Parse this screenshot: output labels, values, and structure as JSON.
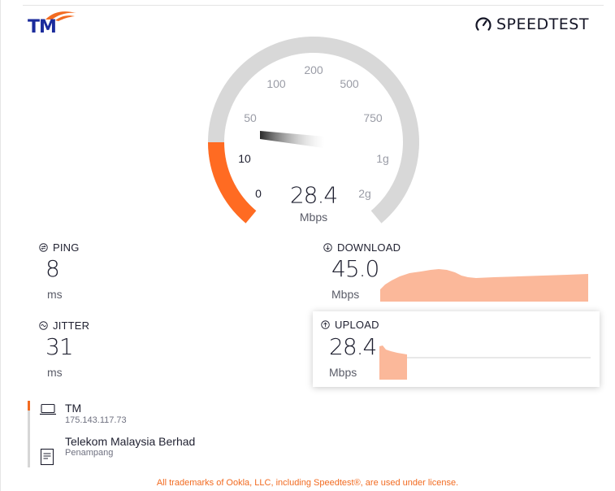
{
  "brand": {
    "isp_logo_text": "TM",
    "speedtest_logo_text": "SPEEDTEST"
  },
  "gauge": {
    "scale_labels": [
      "0",
      "10",
      "50",
      "100",
      "200",
      "500",
      "750",
      "1g",
      "2g"
    ],
    "active_label": "10",
    "value": "28.4",
    "unit": "Mbps",
    "fill_colour": "#ff6b22",
    "track_colour": "#d8d8d8"
  },
  "ping": {
    "label": "PING",
    "value": "8",
    "unit": "ms",
    "icon": "ping-icon"
  },
  "jitter": {
    "label": "JITTER",
    "value": "31",
    "unit": "ms",
    "icon": "jitter-icon"
  },
  "download": {
    "label": "DOWNLOAD",
    "value": "45.0",
    "unit": "Mbps",
    "icon": "download-arrow-icon",
    "graph_colour": "#fbb89a"
  },
  "upload": {
    "label": "UPLOAD",
    "value": "28.4",
    "unit": "Mbps",
    "icon": "upload-arrow-icon",
    "graph_colour": "#fbb89a"
  },
  "client": {
    "isp": "TM",
    "ip": "175.143.117.73",
    "icon": "laptop-icon"
  },
  "server": {
    "name": "Telekom Malaysia Berhad",
    "location": "Penampang",
    "icon": "server-icon"
  },
  "footer": {
    "text": "All trademarks of Ookla, LLC, including Speedtest®, are used under license."
  },
  "colors": {
    "accent": "#f26b21",
    "text": "#1f2030",
    "muted": "#5a5c68"
  }
}
